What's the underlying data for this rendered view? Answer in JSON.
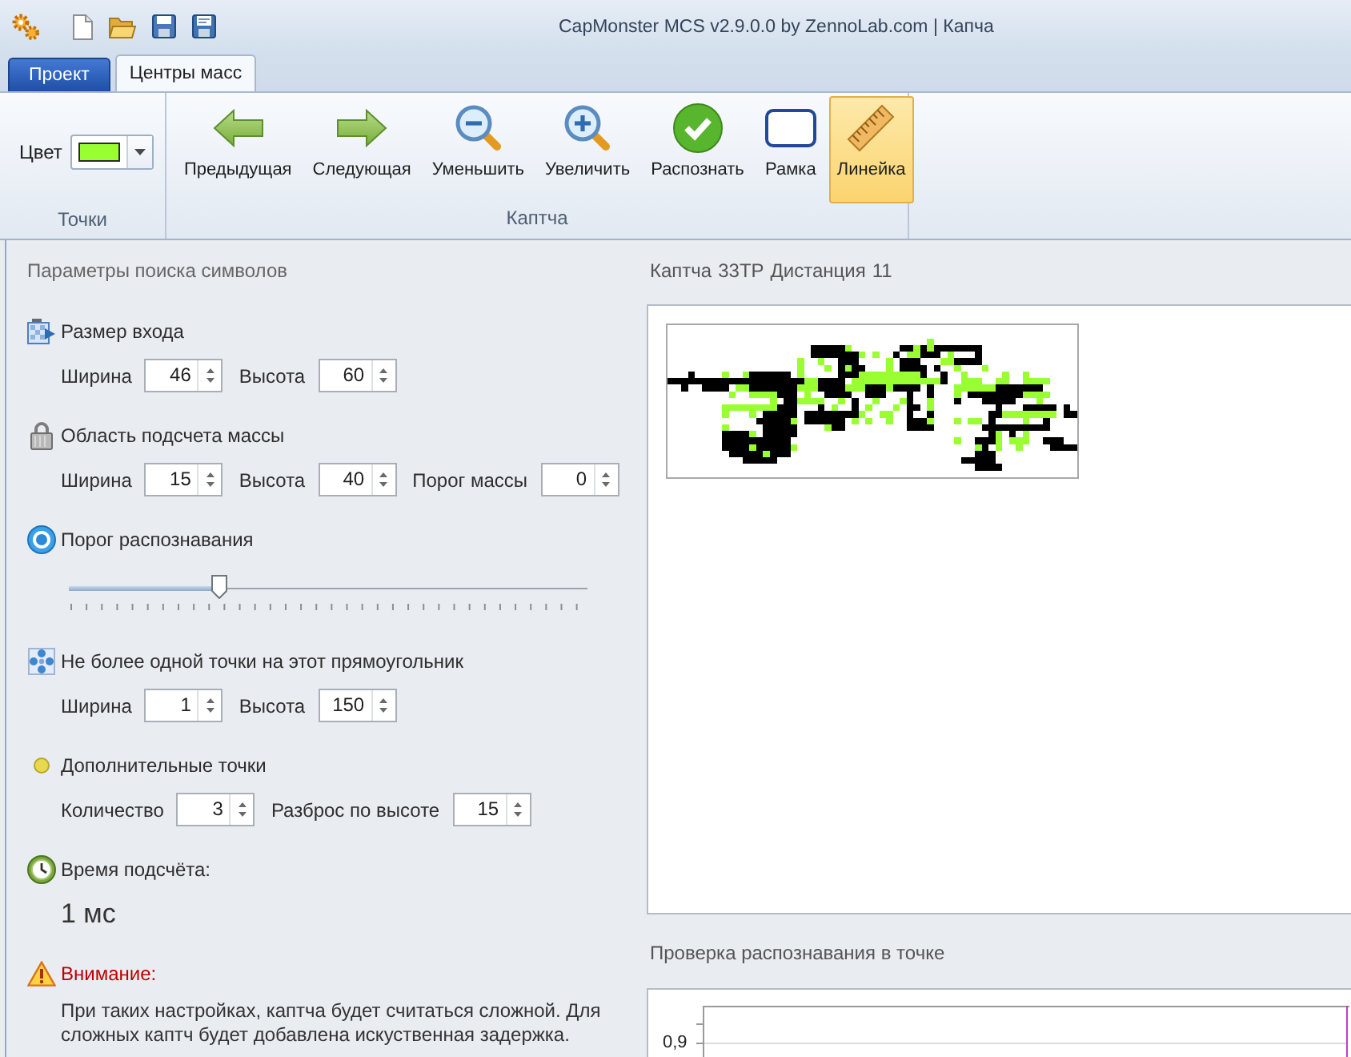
{
  "window": {
    "title": "CapMonster MCS v2.9.0.0 by ZennoLab.com | Капча"
  },
  "tabs": [
    {
      "label": "Проект",
      "kind": "application",
      "selected": false
    },
    {
      "label": "Центры масс",
      "kind": "page",
      "selected": true
    }
  ],
  "ribbon": {
    "points_group": {
      "label": "Точки",
      "color_picker": {
        "label": "Цвет",
        "color": "#99ff33"
      }
    },
    "captcha_group": {
      "label": "Каптча",
      "buttons": [
        {
          "kind": "previous",
          "label": "Предыдущая",
          "on": false
        },
        {
          "kind": "next",
          "label": "Следующая",
          "on": false
        },
        {
          "kind": "zoom-out",
          "label": "Уменьшить",
          "on": false
        },
        {
          "kind": "zoom-in",
          "label": "Увеличить",
          "on": false
        },
        {
          "kind": "recognize",
          "label": "Распознать",
          "on": false
        },
        {
          "kind": "frame",
          "label": "Рамка",
          "on": false
        },
        {
          "kind": "ruler",
          "label": "Линейка",
          "on": true
        }
      ]
    }
  },
  "search_params": {
    "title": "Параметры поиска символов",
    "sections": [
      {
        "kind": "input-size",
        "title": "Размер входа",
        "fields": [
          {
            "label": "Ширина",
            "value": "46"
          },
          {
            "label": "Высота",
            "value": "60"
          }
        ]
      },
      {
        "kind": "mass-area",
        "title": "Область подсчета массы",
        "fields": [
          {
            "label": "Ширина",
            "value": "15"
          },
          {
            "label": "Высота",
            "value": "40"
          },
          {
            "label": "Порог массы",
            "value": "0"
          }
        ]
      },
      {
        "kind": "threshold",
        "title": "Порог распознавания",
        "slider": {
          "level": 0.29
        }
      },
      {
        "kind": "one-point",
        "title": "Не более одной точки на этот прямоугольник",
        "fields": [
          {
            "label": "Ширина",
            "value": "1"
          },
          {
            "label": "Высота",
            "value": "150"
          }
        ]
      },
      {
        "kind": "extra-points",
        "title": "Дополнительные точки",
        "fields": [
          {
            "label": "Количество",
            "value": "3"
          },
          {
            "label": "Разброс по высоте",
            "value": "15"
          }
        ]
      },
      {
        "kind": "timing",
        "title": "Время подсчёта:",
        "reading": "1 мс"
      },
      {
        "kind": "warning",
        "title": "Внимание:",
        "text": "При таких настройках, каптча будет считаться сложной. Для сложных каптч будет добавлена искуственная задержка."
      }
    ]
  },
  "captcha_view": {
    "label": "Каптча",
    "answer": "33TP",
    "distance_label": "Дистанция",
    "distance": "11"
  },
  "recognition_check": {
    "title": "Проверка распознавания в точке",
    "y_tick_label": "0,9"
  }
}
